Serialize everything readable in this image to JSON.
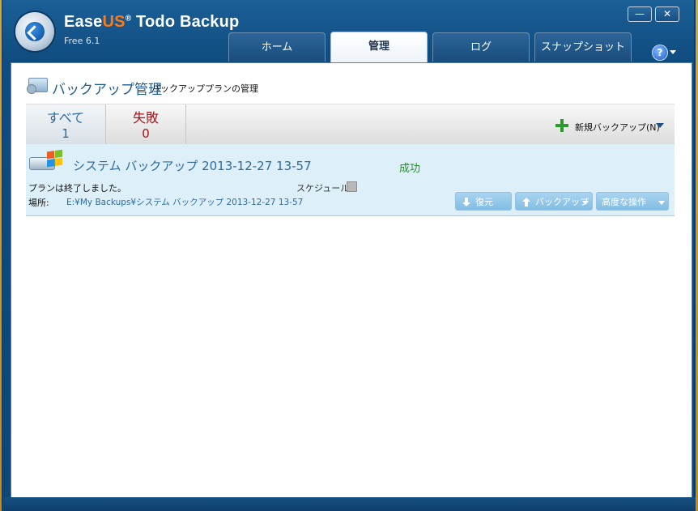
{
  "app": {
    "name_main": "Ease",
    "name_us": "US",
    "name_rest": "Todo Backup",
    "registered": "®",
    "version": "Free 6.1",
    "minimize_glyph": "—",
    "close_glyph": "✕",
    "help_glyph": "?"
  },
  "tabs": [
    {
      "label": "ホーム",
      "active": false
    },
    {
      "label": "管理",
      "active": true
    },
    {
      "label": "ログ",
      "active": false
    },
    {
      "label": "スナップショット",
      "active": false
    }
  ],
  "page": {
    "title": "バックアップ管理",
    "subtitle": "バックアッププランの管理"
  },
  "filters": {
    "all": {
      "label": "すべて",
      "count": "1"
    },
    "failed": {
      "label": "失敗",
      "count": "0"
    }
  },
  "toolbar": {
    "new_backup": "新規バックアップ(N)"
  },
  "plan": {
    "name": "システム バックアップ 2013-12-27 13-57",
    "status": "成功",
    "status_color": "#2b8c2b",
    "finished_text": "プランは終了しました。",
    "schedule_label": "スケジュール",
    "location_label": "場所:",
    "location_value": "E:¥My Backups¥システム バックアップ 2013-12-27 13-57",
    "actions": {
      "restore": "復元",
      "backup": "バックアップ",
      "advanced": "高度な操作"
    }
  },
  "colors": {
    "accent": "#1e5b8f",
    "failed": "#a8141a",
    "add": "#2a9a2f"
  }
}
